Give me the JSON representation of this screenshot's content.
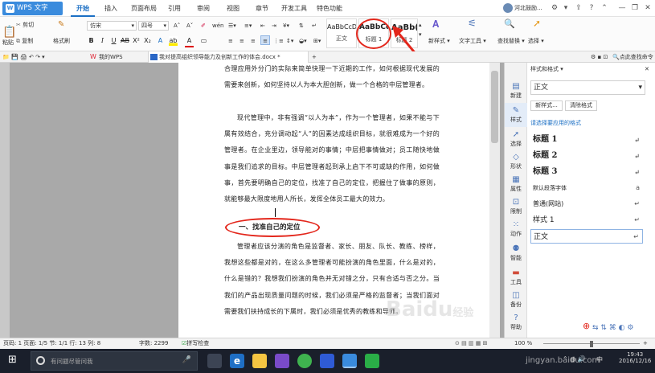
{
  "app": {
    "title": "WPS 文字",
    "logo": "W"
  },
  "menu": [
    "开始",
    "插入",
    "页面布局",
    "引用",
    "审阅",
    "视图",
    "章节",
    "开发工具",
    "特色功能"
  ],
  "user": {
    "name": "河北鼓励..."
  },
  "ribbon": {
    "cut": "剪切",
    "paste": "粘贴",
    "copy": "复制",
    "format_painter": "格式刷",
    "font_name": "仿宋",
    "font_size": "四号",
    "bold": "B",
    "italic": "I",
    "underline": "U",
    "styles": [
      {
        "sample": "AaBbCcDd",
        "name": "正文"
      },
      {
        "sample": "AaBbCc",
        "name": "标题 1"
      },
      {
        "sample": "AaBb(",
        "name": "标题 2"
      }
    ],
    "new_style": "新样式",
    "text_tools": "文字工具",
    "find_replace": "查找替换",
    "select": "选择"
  },
  "tabs": [
    {
      "label": "我的WPS"
    },
    {
      "label": "我对提高组织领导能力及创新工作的体会.docx *"
    }
  ],
  "tabbar_right": "点此查找命令",
  "document": {
    "para1": "合理应用外分门的实际来简单快理一下近期的工作，如何根据现代发展的需要来创新，如何坚持以人为本大胆创新，做一个合格的中层管理者。",
    "para2": "现代管理中，非有强调“以人为本”，作为一个管理者，如果不能与下属有效结合，充分调动起“人”的因素达成组织目标，就很难成为一个好的管理者。在企业里边，领导能对的事情；中层把事情做对；员工随快地做事是我们追求的目标。中层管理者起到承上启下不可或缺的作用，如何做事，首先要明确自己的定位，找准了自己的定位，把握住了做事的原则，就能够最大限度地用人所长，发挥全体员工最大的效力。",
    "heading": "一、找准自己的定位",
    "para3": "管理者应该分演的角色是监督者、家长、朋友、队长、教练、榜样，我想这些都是对的，在这么多管理者可能扮演的角色里面，什么是对的，什么是错的？我想我们扮演的角色并无对错之分，只有合适与否之分。当我们的产品出现质量问题的时候，我们必须是严格的监督者；当我们面对需要我们扶持成长的下属时，我们必须是优秀的教练和导师。"
  },
  "panel": {
    "title": "样式和格式",
    "current_style": "正文",
    "new_style_btn": "新样式...",
    "clear_format_btn": "清除格式",
    "apply_label": "请选择要应用的格式",
    "items": [
      {
        "label": "标题  1",
        "mark": "↵"
      },
      {
        "label": "标题  2",
        "mark": "↵"
      },
      {
        "label": "标题  3",
        "mark": "↵"
      },
      {
        "label": "默认段落字体",
        "mark": "a"
      },
      {
        "label": "普通(网站)",
        "mark": "↵"
      },
      {
        "label": "样式 1",
        "mark": "↵"
      },
      {
        "label": "正文",
        "mark": "↵"
      }
    ],
    "tools": [
      "新建",
      "样式",
      "选择",
      "形状",
      "属性",
      "限制",
      "动作",
      "智能",
      "工具",
      "备份",
      "帮助"
    ]
  },
  "status": {
    "page_info": "页码: 1  页面: 1/5  节: 1/1  行: 13  列: 8",
    "word_count": "字数: 2299",
    "spell": "拼写检查",
    "zoom": "100 %"
  },
  "taskbar": {
    "search_placeholder": "有问题尽管问我",
    "time": "19:43",
    "date": "2016/12/16",
    "lang": "中"
  },
  "watermark": {
    "brand": "Baidu",
    "sub": "经验",
    "url": "jingyan.baidu.com"
  }
}
